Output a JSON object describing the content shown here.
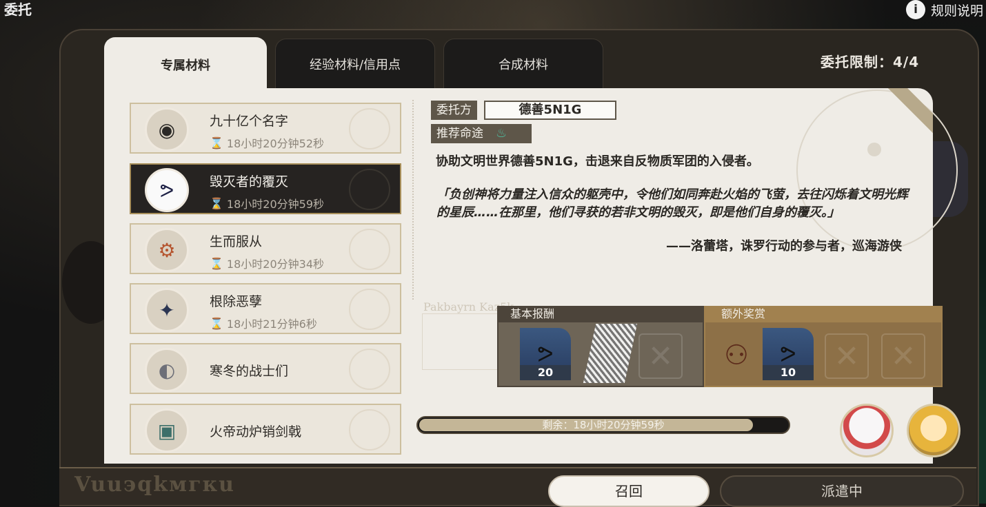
{
  "header": {
    "title": "委托",
    "rules_label": "规则说明",
    "rules_icon": "info-icon"
  },
  "tabs": [
    {
      "label": "专属材料",
      "active": true
    },
    {
      "label": "经验材料/信用点",
      "active": false
    },
    {
      "label": "合成材料",
      "active": false
    }
  ],
  "limit": "委托限制：4/4",
  "commissions": [
    {
      "name": "九十亿个名字",
      "time": "18小时20分钟52秒",
      "icon": "orb-icon"
    },
    {
      "name": "毁灭者的覆灭",
      "time": "18小时20分钟59秒",
      "icon": "ribbon-icon",
      "selected": true
    },
    {
      "name": "生而服从",
      "time": "18小时20分钟34秒",
      "icon": "gear-icon"
    },
    {
      "name": "根除恶孽",
      "time": "18小时21分钟6秒",
      "icon": "shard-icon"
    },
    {
      "name": "寒冬的战士们",
      "time": "",
      "icon": "disc-icon"
    },
    {
      "name": "火帝动炉销剑戟",
      "time": "",
      "icon": "machine-icon"
    }
  ],
  "detail": {
    "client_label": "委托方",
    "client_value": "德善5N1G",
    "path_label": "推荐命途",
    "path_icon": "abundance-path-icon",
    "description": "协助文明世界德善5N1G，击退来自反物质军团的入侵者。",
    "quote": "「负创神将力量注入信众的躯壳中，令他们如同奔赴火焰的飞萤，去往闪烁着文明光辉的星辰……在那里，他们寻获的若非文明的毁灭，即是他们自身的覆灭。」",
    "quote_by": "——洛蕾塔，诛罗行动的参与者，巡海游侠"
  },
  "rewards": {
    "base_label": "基本报酬",
    "extra_label": "额外奖赏",
    "base_count": "20",
    "extra_count": "10"
  },
  "progress": {
    "text": "剩余：18小时20分钟59秒",
    "fill_fraction": 0.9
  },
  "buttons": {
    "recall": "召回",
    "dispatch": "派遣中"
  },
  "colors": {
    "accent": "#c4b697",
    "panel": "#efece6",
    "frame": "#2a2620",
    "path_color": "#4fb89b"
  }
}
